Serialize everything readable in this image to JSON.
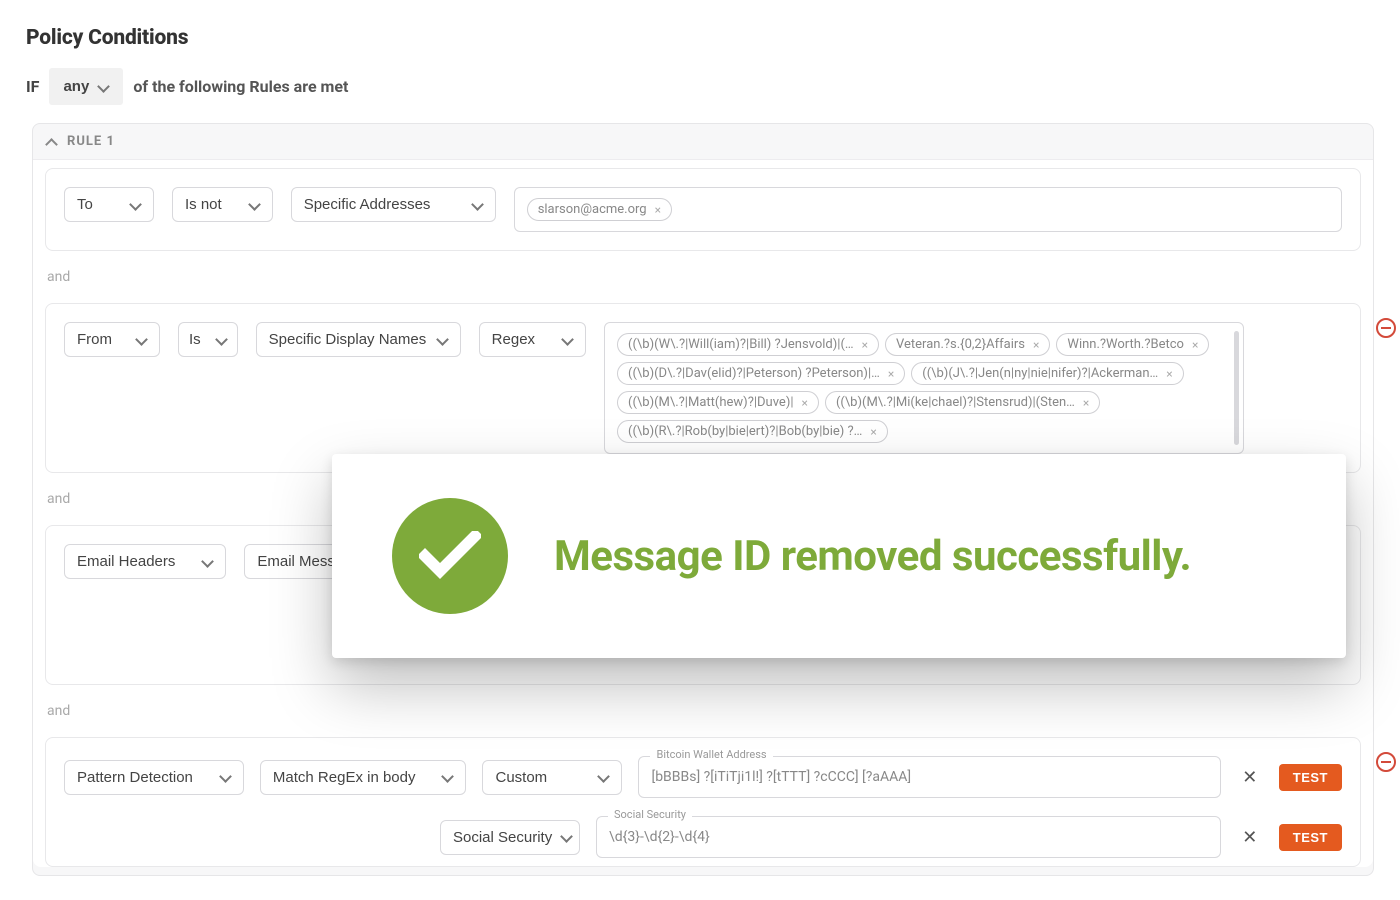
{
  "section_title": "Policy Conditions",
  "if_label": "IF",
  "logic_selector_value": "any",
  "if_suffix": "of the following Rules are met",
  "operator_and": "and",
  "rule": {
    "title": "RULE 1",
    "conditions": [
      {
        "field": "To",
        "comparator": "Is not",
        "match_type": "Specific Addresses",
        "chips": [
          "slarson@acme.org"
        ]
      },
      {
        "field": "From",
        "comparator": "Is",
        "match_type": "Specific Display Names",
        "mode": "Regex",
        "has_remove": true,
        "chips": [
          "((\\b)(W\\.?|Will(iam)?|Bill) ?Jensvold)|(…",
          "Veteran.?s.{0,2}Affairs",
          "Winn.?Worth.?Betco",
          "((\\b)(D\\.?|Dav(elid)?|Peterson) ?Peterson)|…",
          "((\\b)(J\\.?|Jen(n|ny|nie|nifer)?|Ackerman…",
          "((\\b)(M\\.?|Matt(hew)?|Duve)|",
          "((\\b)(M\\.?|Mi(ke|chael)?|Stensrud)|(Sten…",
          "((\\b)(R\\.?|Rob(by|bie|ert)?|Bob(by|bie) ?…"
        ]
      },
      {
        "field": "Email Headers",
        "comparator": "Email Mess"
      },
      {
        "field": "Pattern Detection",
        "comparator": "Match RegEx in body",
        "has_remove": true,
        "patterns": [
          {
            "preset": "Custom",
            "label": "Bitcoin Wallet Address",
            "value": "[bBBBs] ?[iTiTji1l!] ?[tTTT] ?cCCC] [?aAAA]"
          },
          {
            "preset": "Social Security",
            "label": "Social Security",
            "value": "\\d{3}-\\d{2}-\\d{4}"
          }
        ]
      }
    ]
  },
  "buttons": {
    "test": "TEST"
  },
  "toast": {
    "text": "Message ID removed successfully."
  }
}
